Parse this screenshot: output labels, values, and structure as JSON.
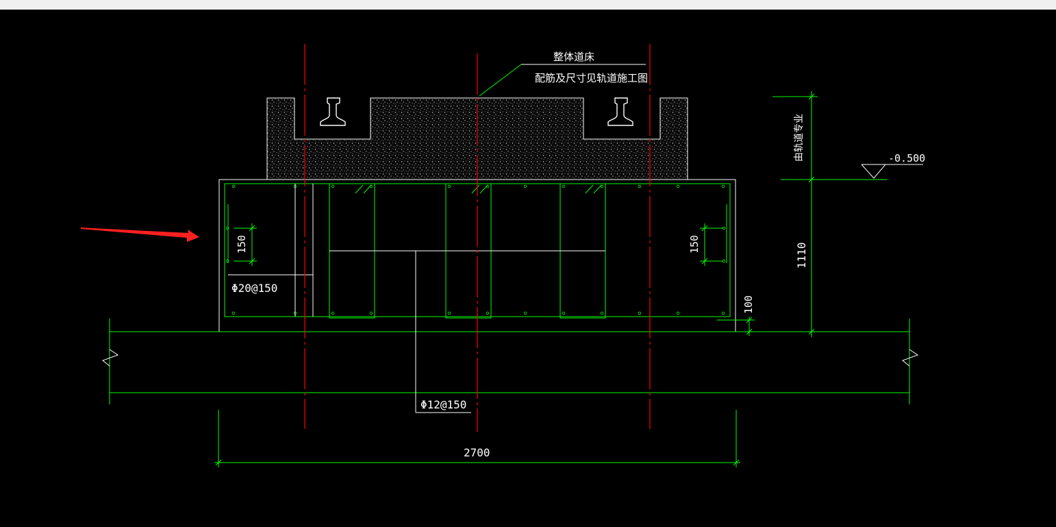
{
  "window": {
    "title": ""
  },
  "drawing": {
    "colors": {
      "background": "#000000",
      "outline": "#ffffff",
      "rebar": "#00ff00",
      "centerline": "#ff0000",
      "arrow": "#ff2020"
    },
    "labels": {
      "bed_title": "整体道床",
      "bed_note": "配筋及尺寸见轨道施工图",
      "elevation_note": "由轨道专业",
      "elevation_value": "-0.500",
      "height_dim": "1110",
      "cover_dim": "100",
      "spacing_left": "150",
      "spacing_right": "150",
      "rebar_side": "Φ20@150",
      "rebar_bottom": "Φ12@150",
      "width_dim": "2700"
    }
  }
}
